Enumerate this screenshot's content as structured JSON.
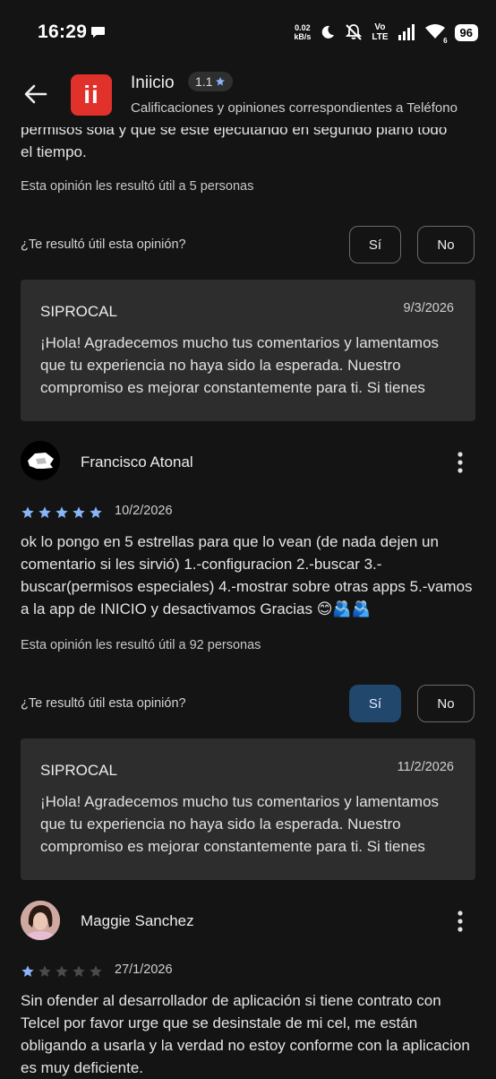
{
  "status_bar": {
    "time": "16:29",
    "speed_value": "0.02",
    "speed_unit": "kB/s",
    "volte_top": "Vo",
    "volte_bottom": "LTE",
    "wifi_label": "6",
    "battery": "96"
  },
  "app_bar": {
    "logo_text": "ii",
    "title": "Iniicio",
    "rating": "1.1",
    "subtitle": "Calificaciones y opiniones correspondientes a Teléfono"
  },
  "review_partial": {
    "text_cut": "permisos sola y que se esté ejecutando en segundo plano todo",
    "text_end": "el tiempo.",
    "helpful_count": "Esta opinión les resultó útil a 5 personas",
    "question": "¿Te resultó útil esta opinión?",
    "yes": "Sí",
    "no": "No",
    "reply": {
      "developer": "SIPROCAL",
      "date": "9/3/2026",
      "text": "¡Hola! Agradecemos mucho tus comentarios y lamentamos que tu experiencia no haya sido la esperada. Nuestro compromiso es mejorar constantemente para ti. Si tienes"
    }
  },
  "review_1": {
    "author": "Francisco Atonal",
    "stars": 5,
    "date": "10/2/2026",
    "text": "ok lo pongo en 5 estrellas para que lo vean (de nada dejen un comentario si les sirvió) 1.-configuracion 2.-buscar 3.-buscar(permisos especiales) 4.-mostrar sobre otras apps 5.-vamos a la app de INICIO y desactivamos Gracias 😊🫂🫂",
    "helpful_count": "Esta opinión les resultó útil a 92 personas",
    "question": "¿Te resultó útil esta opinión?",
    "yes": "Sí",
    "no": "No",
    "yes_selected": true,
    "reply": {
      "developer": "SIPROCAL",
      "date": "11/2/2026",
      "text": "¡Hola! Agradecemos mucho tus comentarios y lamentamos que tu experiencia no haya sido la esperada. Nuestro compromiso es mejorar constantemente para ti. Si tienes"
    }
  },
  "review_2": {
    "author": "Maggie Sanchez",
    "stars": 1,
    "date": "27/1/2026",
    "text": "Sin ofender al desarrollador de aplicación si tiene contrato con Telcel por favor urge que se desinstale de mi cel, me están obligando a usarla y la verdad no estoy conforme con la aplicacion es muy deficiente."
  },
  "colors": {
    "background": "#141414",
    "star_filled": "#8ab4f8",
    "star_empty": "#4a4a4a",
    "selected_button": "#21476d",
    "logo": "#e0312a"
  }
}
